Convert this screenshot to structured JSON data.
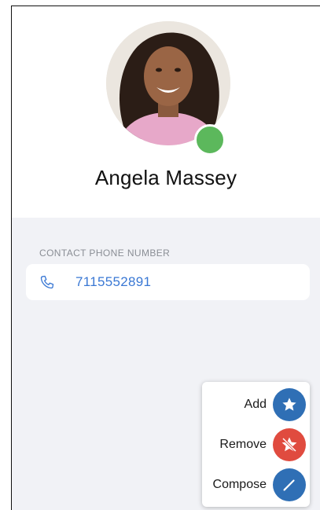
{
  "contact": {
    "name": "Angela Massey",
    "status_color": "#5cb85c"
  },
  "phone_section": {
    "label": "CONTACT PHONE NUMBER",
    "number": "7115552891",
    "icon": "phone-icon"
  },
  "action_menu": {
    "items": [
      {
        "label": "Add",
        "icon": "star-icon",
        "color": "#2f6fb5"
      },
      {
        "label": "Remove",
        "icon": "star-off-icon",
        "color": "#e04b3f"
      },
      {
        "label": "Compose",
        "icon": "pencil-icon",
        "color": "#2f6fb5"
      }
    ]
  },
  "colors": {
    "accent": "#3a78d4",
    "background": "#f1f2f6"
  }
}
